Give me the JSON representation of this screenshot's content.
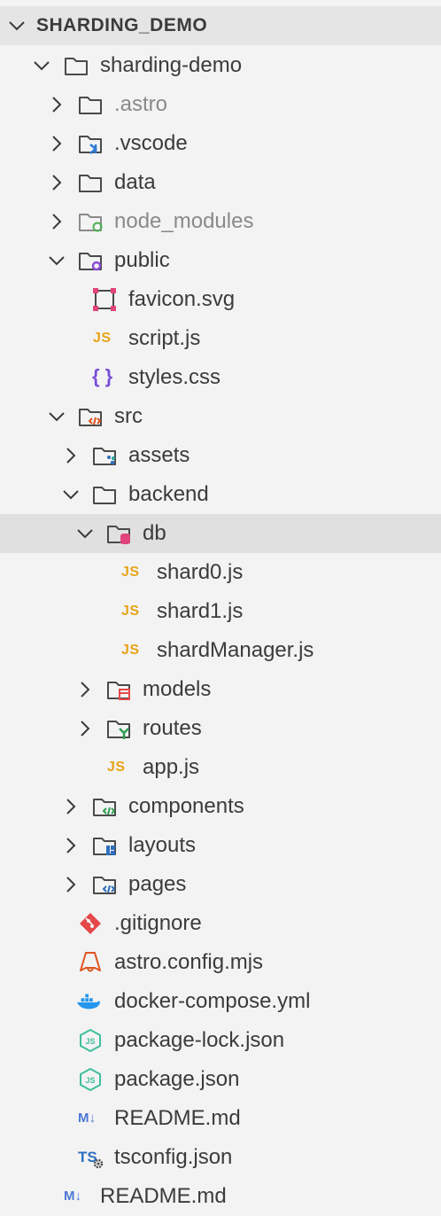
{
  "explorer": {
    "root_title": "SHARDING_DEMO",
    "items": [
      {
        "label": "sharding-demo"
      },
      {
        "label": ".astro"
      },
      {
        "label": ".vscode"
      },
      {
        "label": "data"
      },
      {
        "label": "node_modules"
      },
      {
        "label": "public"
      },
      {
        "label": "favicon.svg"
      },
      {
        "label": "script.js"
      },
      {
        "label": "styles.css"
      },
      {
        "label": "src"
      },
      {
        "label": "assets"
      },
      {
        "label": "backend"
      },
      {
        "label": "db"
      },
      {
        "label": "shard0.js"
      },
      {
        "label": "shard1.js"
      },
      {
        "label": "shardManager.js"
      },
      {
        "label": "models"
      },
      {
        "label": "routes"
      },
      {
        "label": "app.js"
      },
      {
        "label": "components"
      },
      {
        "label": "layouts"
      },
      {
        "label": "pages"
      },
      {
        "label": ".gitignore"
      },
      {
        "label": "astro.config.mjs"
      },
      {
        "label": "docker-compose.yml"
      },
      {
        "label": "package-lock.json"
      },
      {
        "label": "package.json"
      },
      {
        "label": "README.md"
      },
      {
        "label": "tsconfig.json"
      },
      {
        "label": "README.md"
      }
    ]
  },
  "icon_text": {
    "js": "JS",
    "md": "M↓",
    "ts": "TS",
    "css": "{ }"
  },
  "colors": {
    "background": "#f3f3f3",
    "header_bg": "#e5e5e5",
    "selected_bg": "#e0e0e0",
    "text": "#3b3b3b",
    "dimmed_text": "#8a8a8a",
    "js_icon": "#e8a317",
    "json_icon": "#3fbf9b",
    "git_icon": "#e54848",
    "astro_icon": "#e0541f",
    "docker_icon": "#2496ed",
    "markdown_icon": "#4a78d6",
    "ts_icon": "#2d6fbe",
    "svg_icon": "#e0447a",
    "css_icon": "#7a4fd8"
  }
}
